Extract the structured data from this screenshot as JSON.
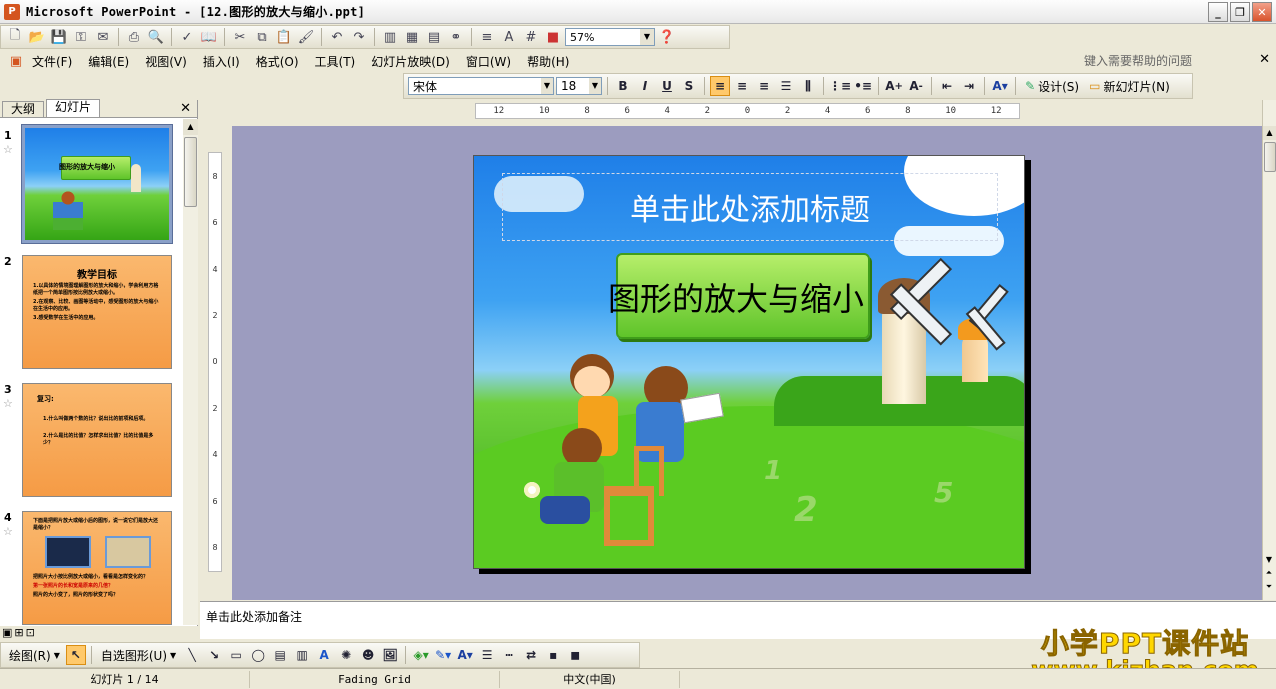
{
  "window": {
    "title": "Microsoft PowerPoint - [12.图形的放大与缩小.ppt]"
  },
  "standard_toolbar": {
    "zoom": "57%"
  },
  "menubar": {
    "items": [
      "文件(F)",
      "编辑(E)",
      "视图(V)",
      "插入(I)",
      "格式(O)",
      "工具(T)",
      "幻灯片放映(D)",
      "窗口(W)",
      "帮助(H)"
    ],
    "help_placeholder": "键入需要帮助的问题"
  },
  "format_toolbar": {
    "font": "宋体",
    "size": "18",
    "bold": "B",
    "italic": "I",
    "underline": "U",
    "shadow": "S",
    "design_label": "设计(S)",
    "new_slide_label": "新幻灯片(N)"
  },
  "left_pane": {
    "tabs": [
      "大纲",
      "幻灯片"
    ],
    "slides": [
      {
        "num": "1",
        "title": "图形的放大与缩小"
      },
      {
        "num": "2",
        "title": "教学目标",
        "lines": [
          "1.以具体的情境图理解图形的放大和缩小，学会利用方格纸把一个简单图形按比例放大或缩小。",
          "2.在观察、比较、画图等活动中，感受图形的放大与缩小在生活中的应用。",
          "3.感受数学在生活中的应用。"
        ]
      },
      {
        "num": "3",
        "title": "复习:",
        "lines": [
          "1.什么叫做两个数的比？说出比的前项和后项。",
          "2.什么是比的比值？怎样求出比值？比的比值是多少？"
        ]
      },
      {
        "num": "4",
        "lines": [
          "下面是把照片放大或缩小后的图形，说一说它们是放大还是缩小？",
          "把照片大小按比例放大或缩小，看看是怎样变化的？",
          "第一张照片的长和宽是原来的几倍？",
          "照片的大小变了，照片的形状变了吗？"
        ]
      }
    ]
  },
  "slide": {
    "title_placeholder": "单击此处添加标题",
    "banner_text": "图形的放大与缩小",
    "numbers": [
      "1",
      "2",
      "5"
    ]
  },
  "ruler": {
    "h_ticks": [
      "12",
      "10",
      "8",
      "6",
      "4",
      "2",
      "0",
      "2",
      "4",
      "6",
      "8",
      "10",
      "12"
    ],
    "v_ticks": [
      "8",
      "6",
      "4",
      "2",
      "0",
      "2",
      "4",
      "6",
      "8"
    ]
  },
  "notes": {
    "placeholder": "单击此处添加备注"
  },
  "draw_toolbar": {
    "draw_label": "绘图(R)",
    "autoshapes_label": "自选图形(U)"
  },
  "statusbar": {
    "slide_info": "幻灯片 1 / 14",
    "design": "Fading Grid",
    "language": "中文(中国)"
  },
  "watermark": {
    "line1": "小学PPT课件站",
    "line2": "www.kjzhan.com"
  },
  "colors": {
    "accent_orange": "#f59b45",
    "selection_blue": "#8aa0c8",
    "sky": "#1f7fe8",
    "grass": "#35a515"
  }
}
